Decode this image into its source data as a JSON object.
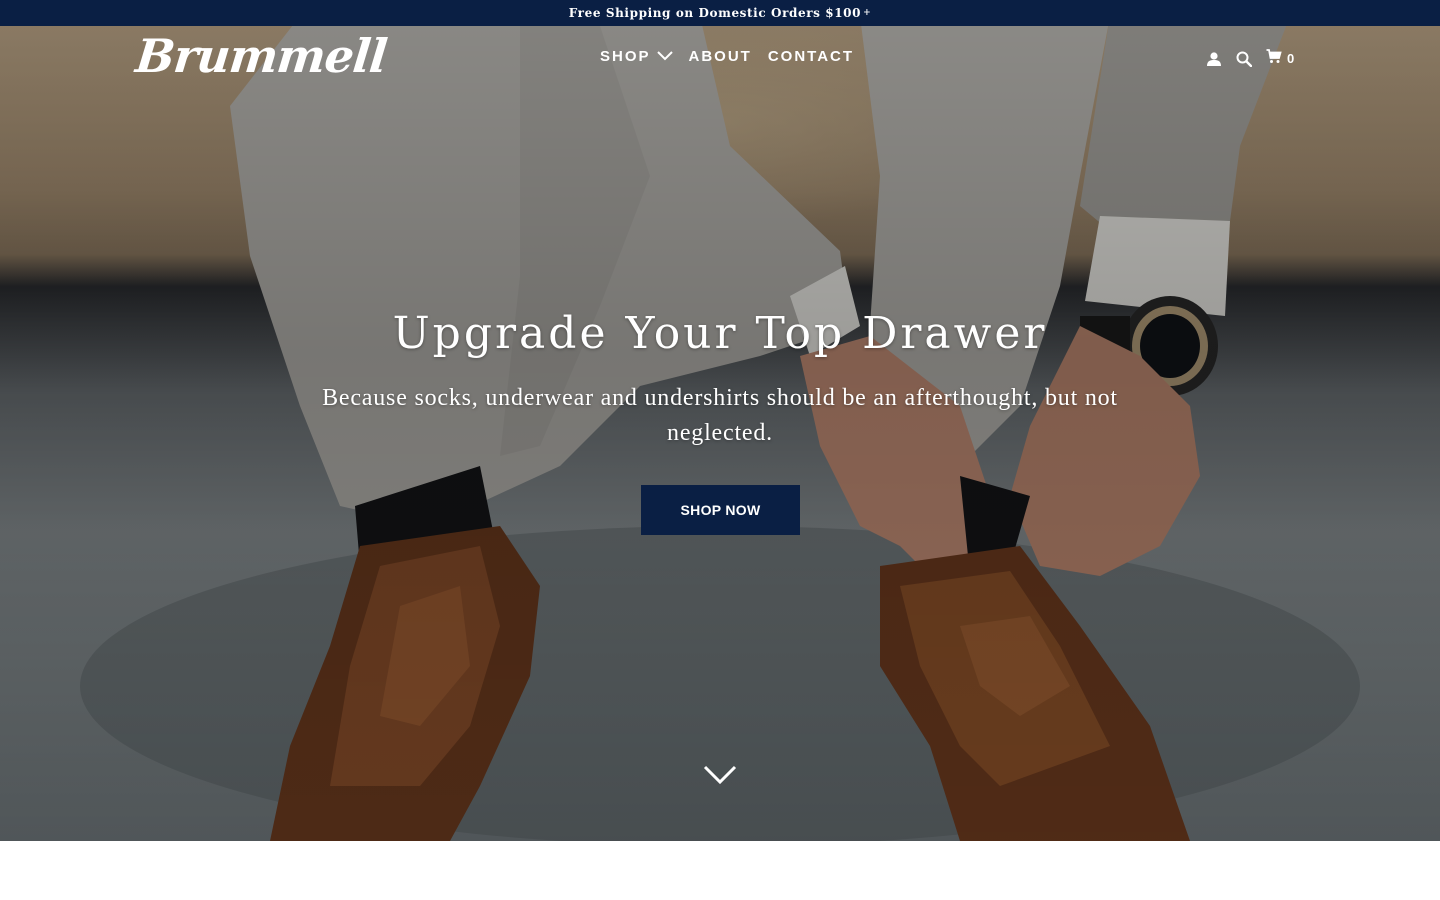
{
  "announcement": {
    "text": "Free Shipping on Domestic Orders $100",
    "suffix": "+"
  },
  "header": {
    "logo": "Brummell",
    "nav": [
      {
        "label": "SHOP",
        "has_dropdown": true
      },
      {
        "label": "ABOUT"
      },
      {
        "label": "CONTACT"
      }
    ],
    "icons": [
      "account-icon",
      "search-icon",
      "cart-icon"
    ],
    "cart_count": "0"
  },
  "hero": {
    "title": "Upgrade Your Top Drawer",
    "subtitle": "Because socks, underwear and undershirts should be an afterthought, but not neglected.",
    "cta_label": "SHOP NOW",
    "scroll_icon": "chevron-down-icon"
  },
  "colors": {
    "brand_navy": "#0a1f44",
    "text_white": "#ffffff"
  }
}
